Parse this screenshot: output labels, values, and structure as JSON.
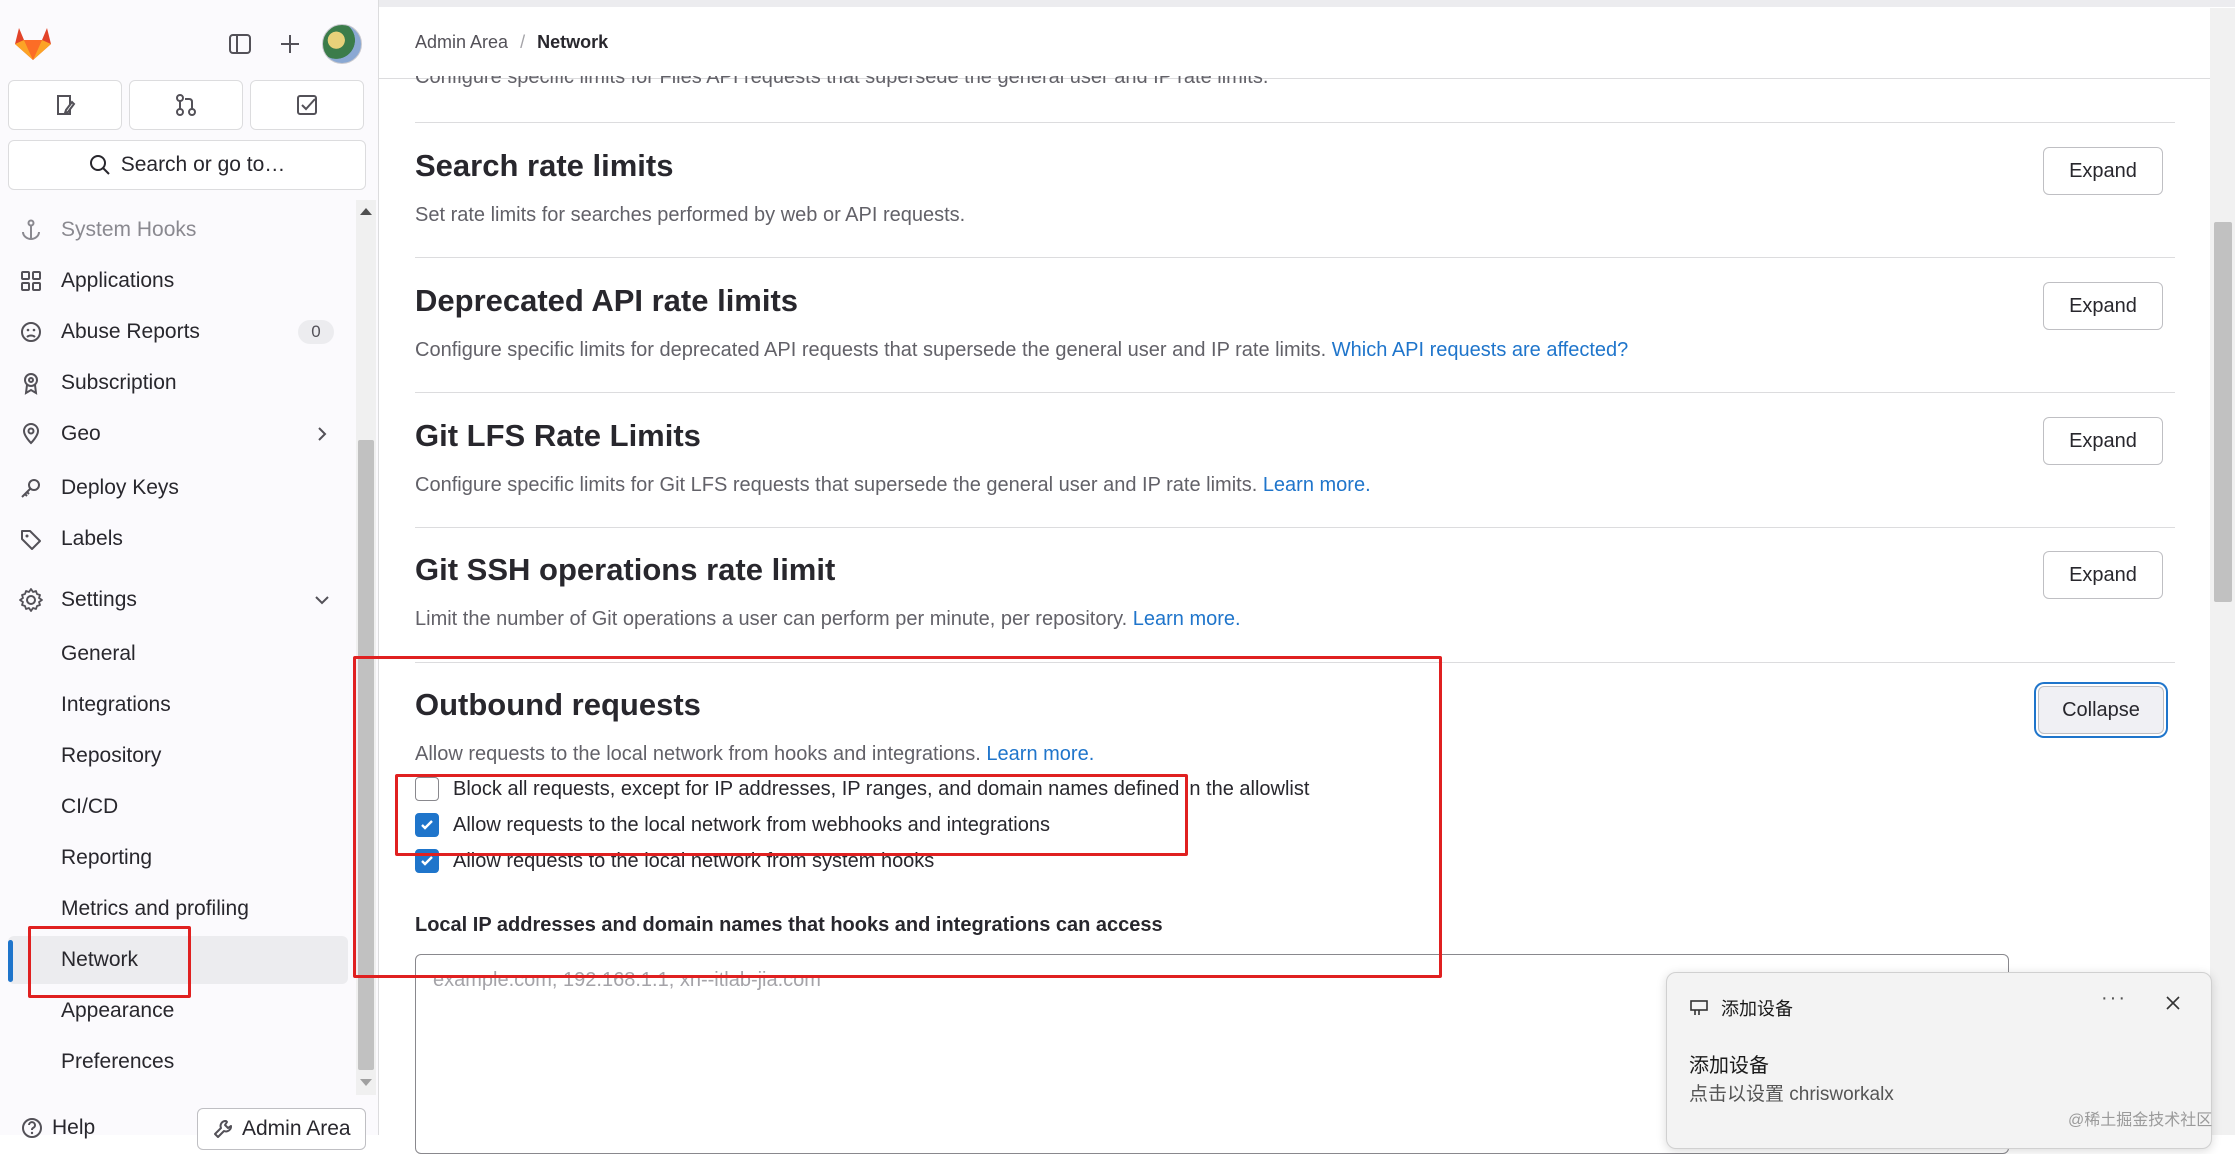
{
  "sidebar": {
    "search_label": "Search or go to…",
    "items": [
      {
        "label": "System Hooks",
        "icon": "anchor-icon",
        "faded": true
      },
      {
        "label": "Applications",
        "icon": "grid-icon"
      },
      {
        "label": "Abuse Reports",
        "icon": "frown-icon",
        "badge": "0"
      },
      {
        "label": "Subscription",
        "icon": "medal-icon"
      },
      {
        "label": "Geo",
        "icon": "location-icon"
      },
      {
        "label": "Deploy Keys",
        "icon": "key-icon"
      },
      {
        "label": "Labels",
        "icon": "label-icon"
      },
      {
        "label": "Settings",
        "icon": "gear-icon"
      }
    ],
    "settings_sub": [
      "General",
      "Integrations",
      "Repository",
      "CI/CD",
      "Reporting",
      "Metrics and profiling",
      "Network",
      "Appearance",
      "Preferences"
    ],
    "active_item": "Network",
    "help_label": "Help",
    "admin_area_label": "Admin Area"
  },
  "breadcrumb": {
    "parent": "Admin Area",
    "separator": "/",
    "current": "Network"
  },
  "cut_off_text": "Configure specific limits for Files API requests that supersede the general user and IP rate limits.",
  "sections": [
    {
      "title": "Search rate limits",
      "desc": "Set rate limits for searches performed by web or API requests.",
      "link": "",
      "button": "Expand"
    },
    {
      "title": "Deprecated API rate limits",
      "desc": "Configure specific limits for deprecated API requests that supersede the general user and IP rate limits.",
      "link": "Which API requests are affected?",
      "button": "Expand"
    },
    {
      "title": "Git LFS Rate Limits",
      "desc": "Configure specific limits for Git LFS requests that supersede the general user and IP rate limits.",
      "link": "Learn more.",
      "button": "Expand"
    },
    {
      "title": "Git SSH operations rate limit",
      "desc": "Limit the number of Git operations a user can perform per minute, per repository.",
      "link": "Learn more.",
      "button": "Expand"
    }
  ],
  "outbound": {
    "title": "Outbound requests",
    "desc": "Allow requests to the local network from hooks and integrations.",
    "link": "Learn more.",
    "button": "Collapse",
    "checkboxes": [
      {
        "label": "Block all requests, except for IP addresses, IP ranges, and domain names defined in the allowlist",
        "checked": false
      },
      {
        "label": "Allow requests to the local network from webhooks and integrations",
        "checked": true
      },
      {
        "label": "Allow requests to the local network from system hooks",
        "checked": true
      }
    ],
    "field_label": "Local IP addresses and domain names that hooks and integrations can access",
    "field_placeholder": "example.com, 192.168.1.1, xn--itlab-jia.com"
  },
  "notification": {
    "app": "添加设备",
    "more": "···",
    "title": "添加设备",
    "body": "点击以设置 chrisworkalx"
  },
  "watermark": "@稀土掘金技术社区",
  "colors": {
    "accent": "#1f75cb",
    "highlight": "#e02020",
    "brand": "#e24329"
  }
}
